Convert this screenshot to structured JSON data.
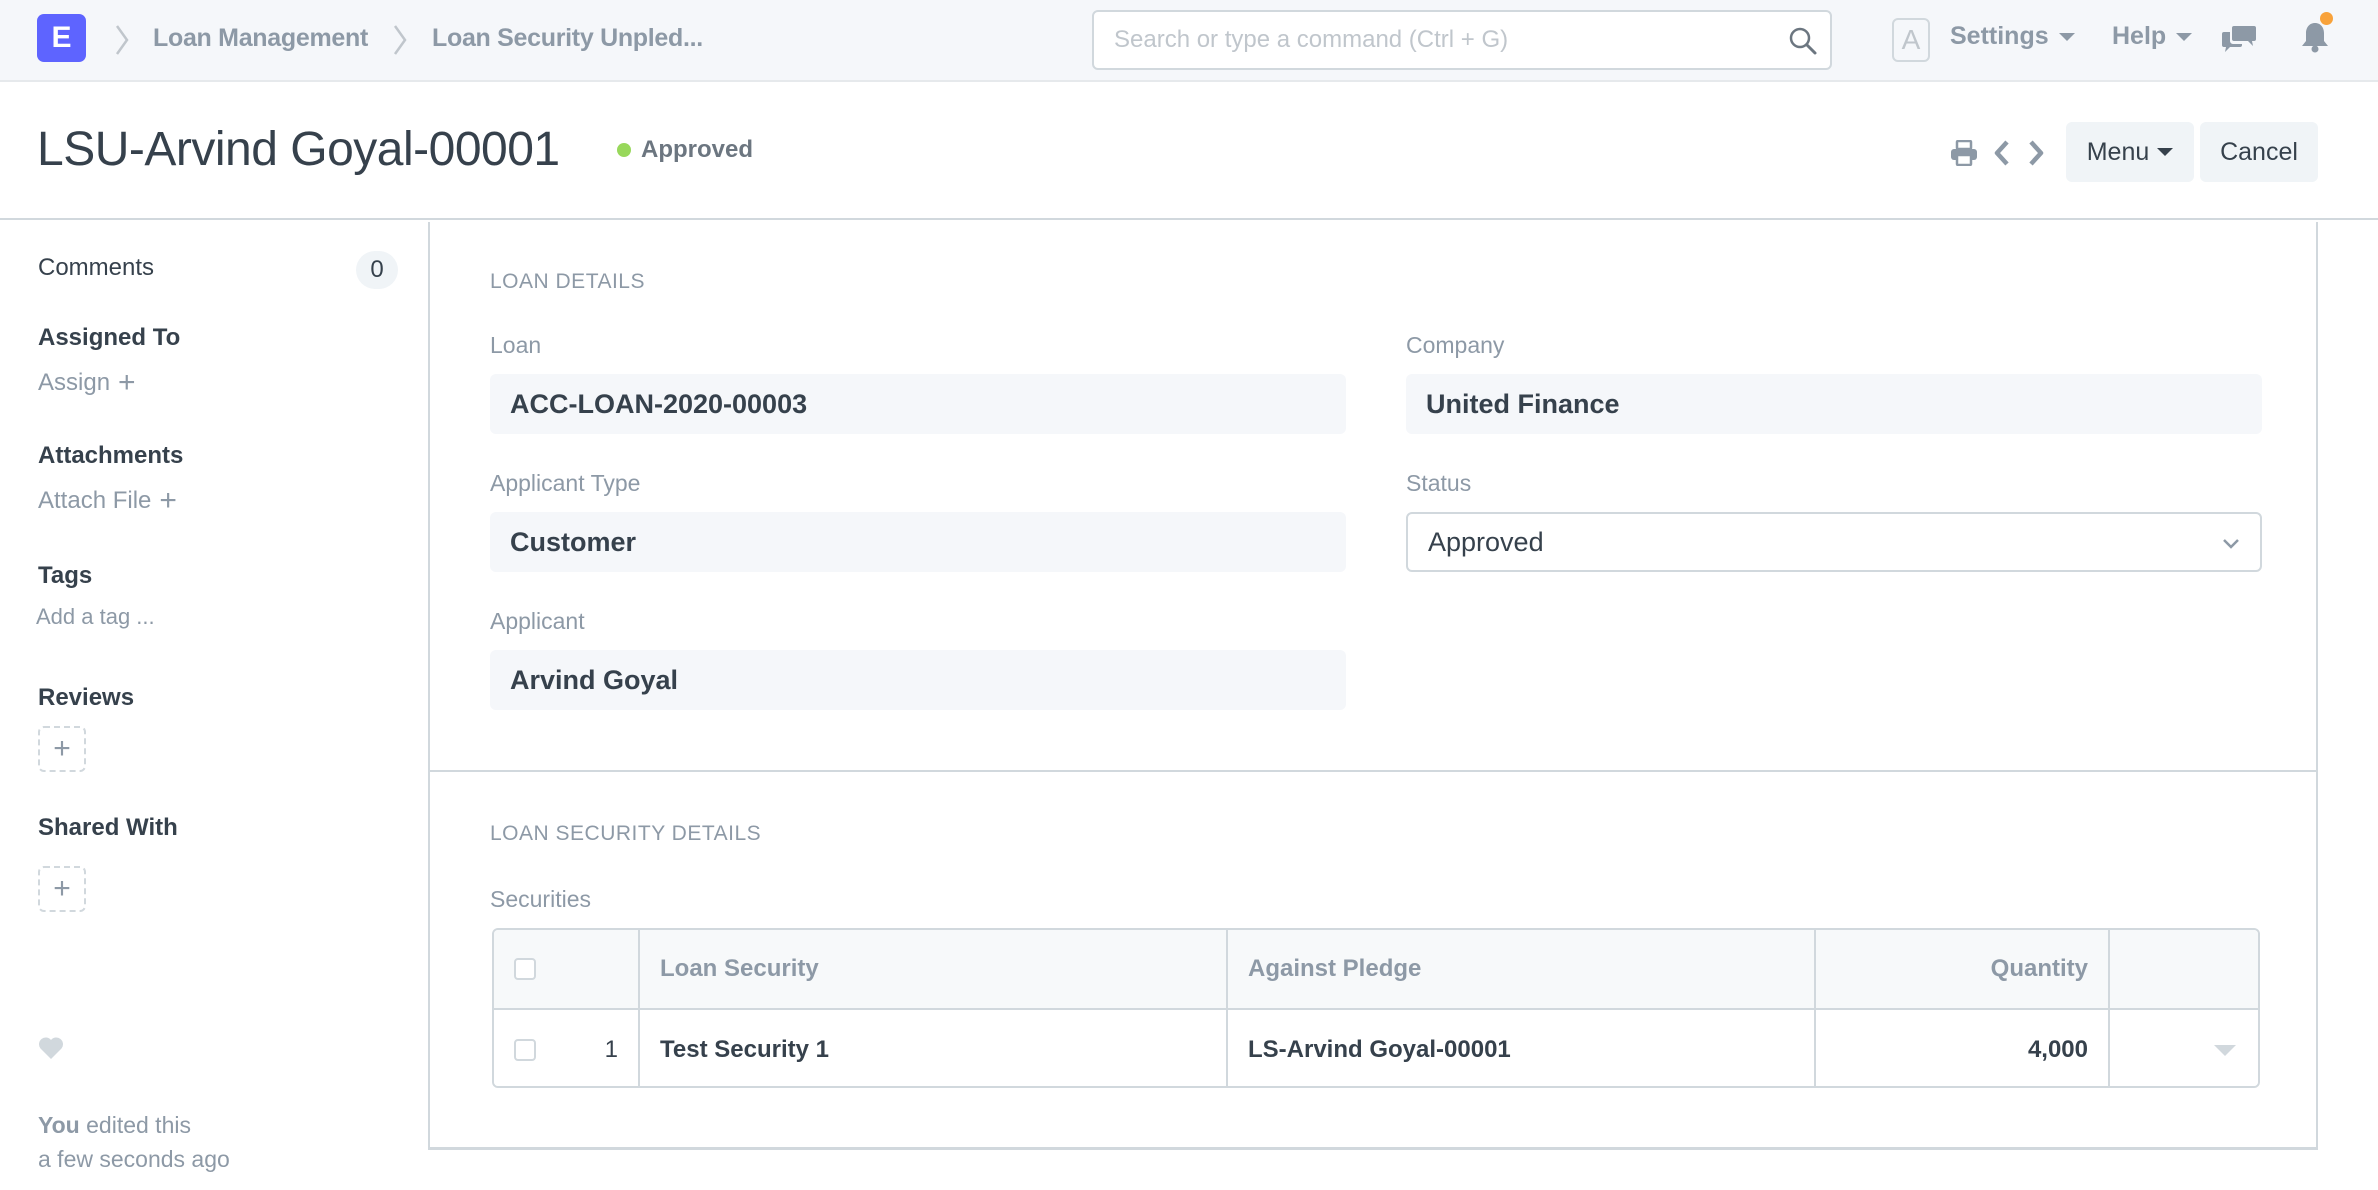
{
  "navbar": {
    "logo_letter": "E",
    "breadcrumbs": [
      "Loan Management",
      "Loan Security Unpled..."
    ],
    "search_placeholder": "Search or type a command (Ctrl + G)",
    "avatar_letter": "A",
    "settings_label": "Settings",
    "help_label": "Help",
    "notification_dot_color": "#f8a23a",
    "brand_color": "#5e64ff"
  },
  "page_head": {
    "title": "LSU-Arvind Goyal-00001",
    "status": "Approved",
    "status_color": "#98d85b",
    "menu_label": "Menu",
    "cancel_label": "Cancel"
  },
  "sidebar": {
    "comments_label": "Comments",
    "comments_count": "0",
    "assigned_to_label": "Assigned To",
    "assign_label": "Assign",
    "attachments_label": "Attachments",
    "attach_file_label": "Attach File",
    "tags_label": "Tags",
    "add_tag_label": "Add a tag ...",
    "reviews_label": "Reviews",
    "shared_with_label": "Shared With",
    "edited_by": "You",
    "edited_text": "edited this",
    "edited_time": "a few seconds ago"
  },
  "form": {
    "loan_details_title": "Loan Details",
    "loan_label": "Loan",
    "loan_value": "ACC-LOAN-2020-00003",
    "company_label": "Company",
    "company_value": "United Finance",
    "applicant_type_label": "Applicant Type",
    "applicant_type_value": "Customer",
    "status_label": "Status",
    "status_value": "Approved",
    "applicant_label": "Applicant",
    "applicant_value": "Arvind Goyal",
    "loan_security_details_title": "Loan Security Details",
    "securities_label": "Securities",
    "securities_table": {
      "columns": [
        "Loan Security",
        "Against Pledge",
        "Quantity"
      ],
      "rows": [
        {
          "idx": "1",
          "loan_security": "Test Security 1",
          "against_pledge": "LS-Arvind Goyal-00001",
          "quantity": "4,000"
        }
      ]
    }
  }
}
